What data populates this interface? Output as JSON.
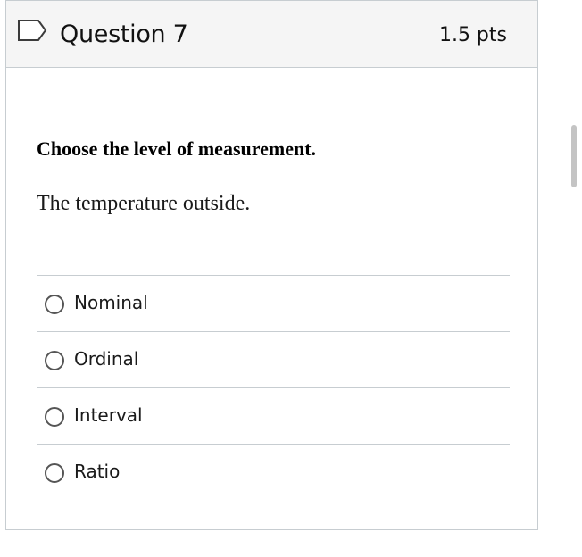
{
  "question": {
    "title": "Question 7",
    "points": "1.5 pts",
    "prompt_bold": "Choose the level of measurement.",
    "prompt_text": "The temperature outside.",
    "answers": [
      {
        "label": "Nominal",
        "selected": false
      },
      {
        "label": "Ordinal",
        "selected": false
      },
      {
        "label": "Interval",
        "selected": false
      },
      {
        "label": "Ratio",
        "selected": false
      }
    ]
  },
  "icons": {
    "flag": "flag-icon",
    "radio": "radio-button"
  },
  "colors": {
    "header_bg": "#f5f5f5",
    "border": "#c7cdd1",
    "flag_stroke": "#3b3b3b",
    "text": "#111111"
  }
}
